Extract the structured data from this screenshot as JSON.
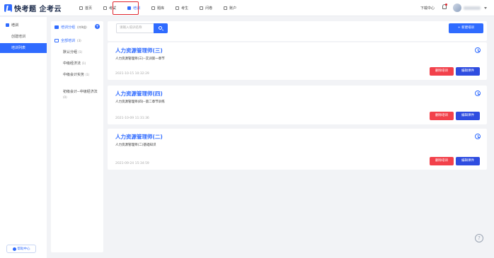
{
  "header": {
    "logo_text": "快考题 企考云",
    "nav": [
      {
        "label": "首页",
        "icon": "home-icon"
      },
      {
        "label": "考试",
        "icon": "exam-icon"
      },
      {
        "label": "培训",
        "icon": "training-icon",
        "active": true
      },
      {
        "label": "题库",
        "icon": "question-bank-icon"
      },
      {
        "label": "考生",
        "icon": "candidate-icon"
      },
      {
        "label": "问卷",
        "icon": "survey-icon"
      },
      {
        "label": "账户",
        "icon": "account-icon"
      }
    ],
    "download_center": "下载中心"
  },
  "sidebar": {
    "group_label": "培训",
    "items": [
      {
        "label": "创建培训"
      },
      {
        "label": "培训列表",
        "active": true
      }
    ],
    "help_center": "帮助中心"
  },
  "categories": {
    "title": "培训分组",
    "total": "(共9组)",
    "all_label": "全部培训",
    "all_count": "(3)",
    "items": [
      {
        "label": "默认分组",
        "count": "(1)"
      },
      {
        "label": "中级经济法",
        "count": "(1)"
      },
      {
        "label": "中级会计实务",
        "count": "(1)"
      },
      {
        "label": "初级会计--中级经济法",
        "count": "(0)"
      }
    ]
  },
  "toolbar": {
    "search_placeholder": "请输入培训名称",
    "new_button": "+ 新建培训"
  },
  "cards": [
    {
      "title": "人力资源管理师(三)",
      "desc": "人力资源管理师(三)--实训第一章节",
      "time": "2021-10-15 10:32:29",
      "delete": "删除培训",
      "edit": "编辑课件"
    },
    {
      "title": "人力资源管理师(四)",
      "desc": "人力资源管理师(四)--第二章节训练",
      "time": "2021-10-09 11:31:36",
      "delete": "删除培训",
      "edit": "编辑课件"
    },
    {
      "title": "人力资源管理师(二)",
      "desc": "人力资源管理师(二)基础知识",
      "time": "2021-09-24 15:34:59",
      "delete": "删除培训",
      "edit": "编辑课件"
    }
  ],
  "colors": {
    "accent": "#2f6bff",
    "danger": "#f2414b",
    "highlight": "#e0262f"
  }
}
